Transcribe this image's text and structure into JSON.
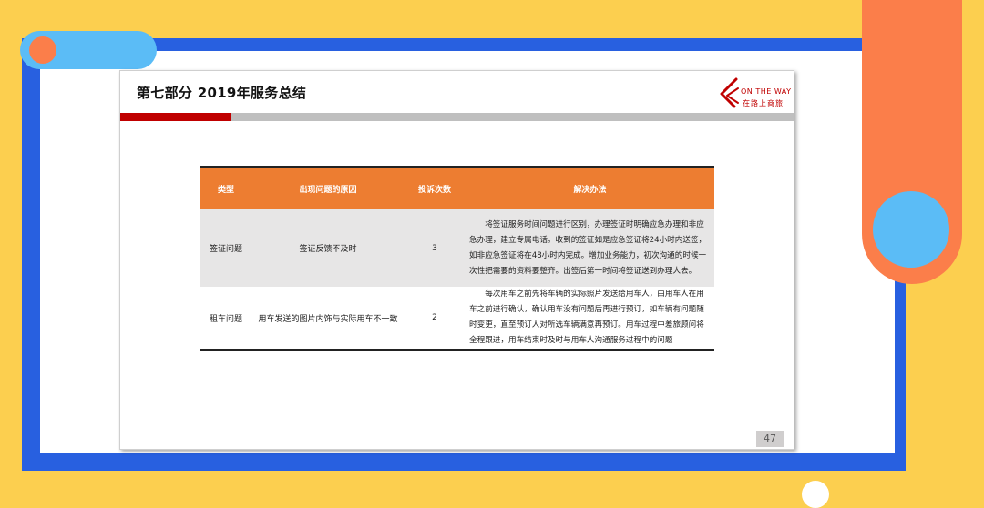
{
  "slide": {
    "title": "第七部分  2019年服务总结",
    "logo": {
      "en": "ON THE WAY",
      "cn": "在路上商旅"
    },
    "page_number": "47"
  },
  "table": {
    "headers": [
      "类型",
      "出现问题的原因",
      "投诉次数",
      "解决办法"
    ],
    "rows": [
      {
        "type": "签证问题",
        "reason": "签证反馈不及时",
        "count": "3",
        "solution": "将签证服务时间问题进行区别，办理签证时明确应急办理和非应急办理，建立专属电话。收到的签证如是应急签证将24小时内送签，如非应急签证将在48小时内完成。增加业务能力，初次沟通的时候一次性把需要的资料要整齐。出签后第一时间将签证送到办理人去。"
      },
      {
        "type": "租车问题",
        "reason": "用车发送的图片内饰与实际用车不一致",
        "count": "2",
        "solution": "每次用车之前先将车辆的实际照片发送给用车人，由用车人在用车之前进行确认，确认用车没有问题后再进行预订，如车辆有问题随时变更，直至预订人对所选车辆满意再预订。用车过程中差旅顾问将全程跟进，用车结束时及时与用车人沟通服务过程中的问题"
      }
    ]
  },
  "colors": {
    "background": "#fccf4f",
    "blue": "#2860e0",
    "orange": "#fb7e4a",
    "light_blue": "#5bbcf6",
    "table_header": "#ed7d31",
    "accent_red": "#c00000"
  }
}
